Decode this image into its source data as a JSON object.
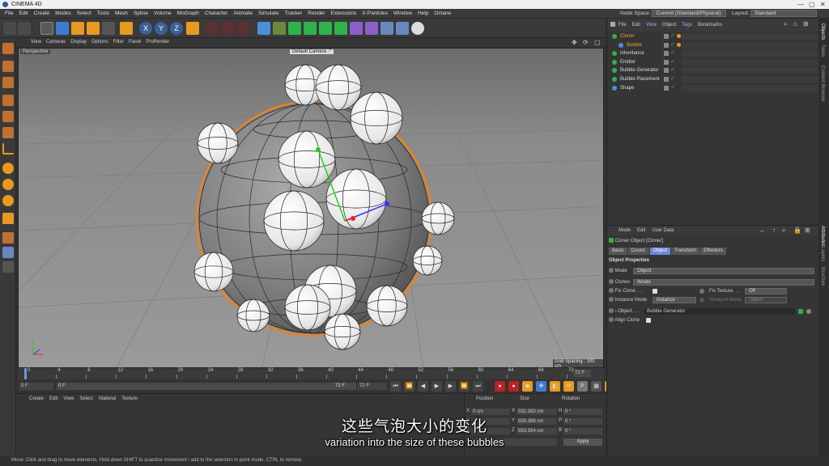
{
  "window": {
    "title": "CINEMA 4D",
    "controls": [
      "—",
      "▢",
      "✕"
    ]
  },
  "menu": [
    "File",
    "Edit",
    "Create",
    "Modes",
    "Select",
    "Tools",
    "Mesh",
    "Spline",
    "Volume",
    "MoGraph",
    "Character",
    "Animate",
    "Simulate",
    "Tracker",
    "Render",
    "Extensions",
    "X-Particles",
    "Window",
    "Help",
    "Octane"
  ],
  "node_space": {
    "label": "Node Space:",
    "value": "Current (Standard/Physical)"
  },
  "layout": {
    "label": "Layout:",
    "value": "Standard"
  },
  "viewport": {
    "menu": [
      "View",
      "Cameras",
      "Display",
      "Options",
      "Filter",
      "Panel",
      "ProRender"
    ],
    "label": "Perspective",
    "camera": "Default Camera ·°",
    "grid_spacing": "Grid Spacing : 100 cm"
  },
  "timeline": {
    "ticks": [
      "0",
      "4",
      "8",
      "12",
      "16",
      "20",
      "24",
      "28",
      "32",
      "36",
      "40",
      "44",
      "48",
      "52",
      "56",
      "60",
      "64",
      "68",
      "72"
    ],
    "end_frame": "72 F",
    "current": "0 F",
    "start": "0 F",
    "preview_end": "72 F",
    "range_end": "72 F"
  },
  "materials": {
    "menu": [
      "Create",
      "Edit",
      "View",
      "Select",
      "Material",
      "Texture"
    ]
  },
  "coords": {
    "headers": [
      "Position",
      "Size",
      "Rotation"
    ],
    "rows": [
      {
        "axis": "X",
        "pos": "0 cm",
        "size_axis": "H",
        "rot": "0 °"
      },
      {
        "axis": "Y",
        "pos": "559.368 cm",
        "size_axis": "P",
        "rot": "0 °"
      },
      {
        "axis": "Z",
        "pos": "553.954 cm",
        "size_axis": "B",
        "rot": "0 °"
      }
    ],
    "x_size": "532.383 cm",
    "apply": "Apply"
  },
  "objects": {
    "menu": [
      "File",
      "Edit",
      "View",
      "Object",
      "Tags",
      "Bookmarks"
    ],
    "items": [
      {
        "name": "Cloner",
        "color": "#f0a030",
        "indent": 0
      },
      {
        "name": "Bubble",
        "color": "#f0a030",
        "indent": 1
      },
      {
        "name": "Inheritance",
        "color": "#ddd",
        "indent": 0
      },
      {
        "name": "Emitter",
        "color": "#ddd",
        "indent": 0
      },
      {
        "name": "Bubble Generator",
        "color": "#ddd",
        "indent": 0
      },
      {
        "name": "Bubble Placement",
        "color": "#ddd",
        "indent": 0
      },
      {
        "name": "Shape",
        "color": "#ddd",
        "indent": 0
      }
    ]
  },
  "attributes": {
    "menu": [
      "Mode",
      "Edit",
      "User Data"
    ],
    "title": "Cloner Object [Cloner]",
    "tabs": [
      "Basic",
      "Coord.",
      "Object",
      "Transform",
      "Effectors"
    ],
    "active_tab": "Object",
    "section": "Object Properties",
    "mode_label": "Mode",
    "mode_value": "Object",
    "clones_label": "Clones",
    "clones_value": "Iterate",
    "fix_clone": "Fix Clone . . .",
    "fix_texture": "Fix Texture. . .",
    "fix_texture_value": "Off",
    "instance_mode": "Instance Mode",
    "instance_value": "Instance",
    "viewport_mode": "Viewport Mode",
    "viewport_value": "Object",
    "object_label": "Object. . .",
    "object_value": "Bubble Generator",
    "align_clone": "Align Clone"
  },
  "side_tabs": [
    "Objects",
    "Takes",
    "Content Browser",
    "Attributes",
    "Layers",
    "Structure"
  ],
  "status": "Move: Click and drag to move elements. Hold down SHIFT to quantize movement / add to the selection in point mode, CTRL to remove.",
  "subtitles": {
    "zh": "这些气泡大小的变化",
    "en": "variation into the size of these bubbles"
  }
}
